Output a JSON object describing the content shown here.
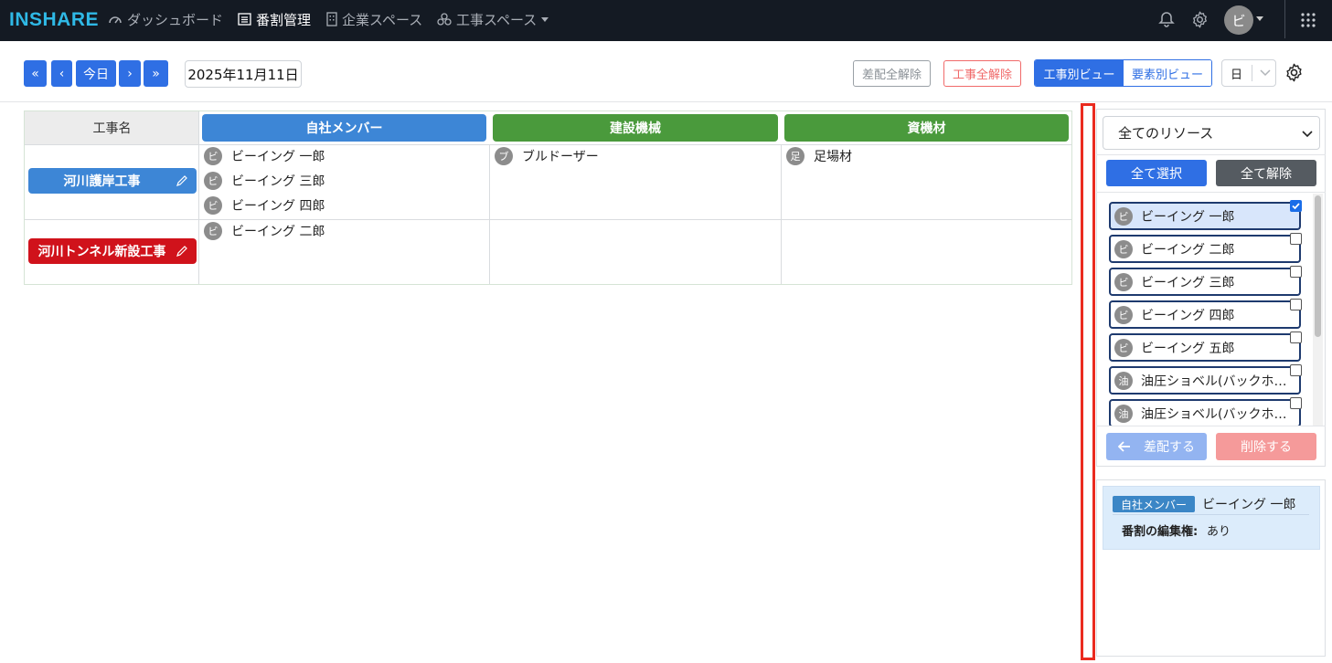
{
  "nav": {
    "logo": "INSHARE",
    "items": [
      {
        "label": "ダッシュボード",
        "icon": "dashboard-icon"
      },
      {
        "label": "番割管理",
        "icon": "list-icon"
      },
      {
        "label": "企業スペース",
        "icon": "building-icon"
      },
      {
        "label": "工事スペース",
        "icon": "group-icon"
      }
    ],
    "avatar": "ビ"
  },
  "toolbar": {
    "first": "«",
    "prev": "‹",
    "today": "今日",
    "next": "›",
    "last": "»",
    "date": "2025年11月11日",
    "clear_dispatch": "差配全解除",
    "clear_construction": "工事全解除",
    "view_construction": "工事別ビュー",
    "view_element": "要素別ビュー",
    "period": "日"
  },
  "table": {
    "header_name": "工事名",
    "categories": [
      {
        "label": "自社メンバー",
        "color": "#3d86d6"
      },
      {
        "label": "建設機械",
        "color": "#4a9a3c"
      },
      {
        "label": "資機材",
        "color": "#4a9a3c"
      }
    ],
    "rows": [
      {
        "name": "河川護岸工事",
        "color": "#3d86d6",
        "members": [
          {
            "badge": "ビ",
            "name": "ビーイング 一郎"
          },
          {
            "badge": "ビ",
            "name": "ビーイング 三郎"
          },
          {
            "badge": "ビ",
            "name": "ビーイング 四郎"
          }
        ],
        "machines": [
          {
            "badge": "ブ",
            "name": "ブルドーザー"
          }
        ],
        "materials": [
          {
            "badge": "足",
            "name": "足場材"
          }
        ]
      },
      {
        "name": "河川トンネル新設工事",
        "color": "#d0121b",
        "members": [
          {
            "badge": "ビ",
            "name": "ビーイング 二郎"
          }
        ],
        "machines": [],
        "materials": []
      }
    ]
  },
  "panel": {
    "resource_filter": "全てのリソース",
    "select_all": "全て選択",
    "clear_all": "全て解除",
    "resources": [
      {
        "badge": "ビ",
        "name": "ビーイング 一郎",
        "checked": true
      },
      {
        "badge": "ビ",
        "name": "ビーイング 二郎",
        "checked": false
      },
      {
        "badge": "ビ",
        "name": "ビーイング 三郎",
        "checked": false
      },
      {
        "badge": "ビ",
        "name": "ビーイング 四郎",
        "checked": false
      },
      {
        "badge": "ビ",
        "name": "ビーイング 五郎",
        "checked": false
      },
      {
        "badge": "油",
        "name": "油圧ショベル(バックホー…",
        "checked": false
      },
      {
        "badge": "油",
        "name": "油圧ショベル(バックホー…",
        "checked": false
      }
    ],
    "assign": "差配する",
    "delete": "削除する"
  },
  "detail": {
    "tag": "自社メンバー",
    "name": "ビーイング 一郎",
    "perm_label": "番割の編集権:",
    "perm_value": "あり"
  }
}
